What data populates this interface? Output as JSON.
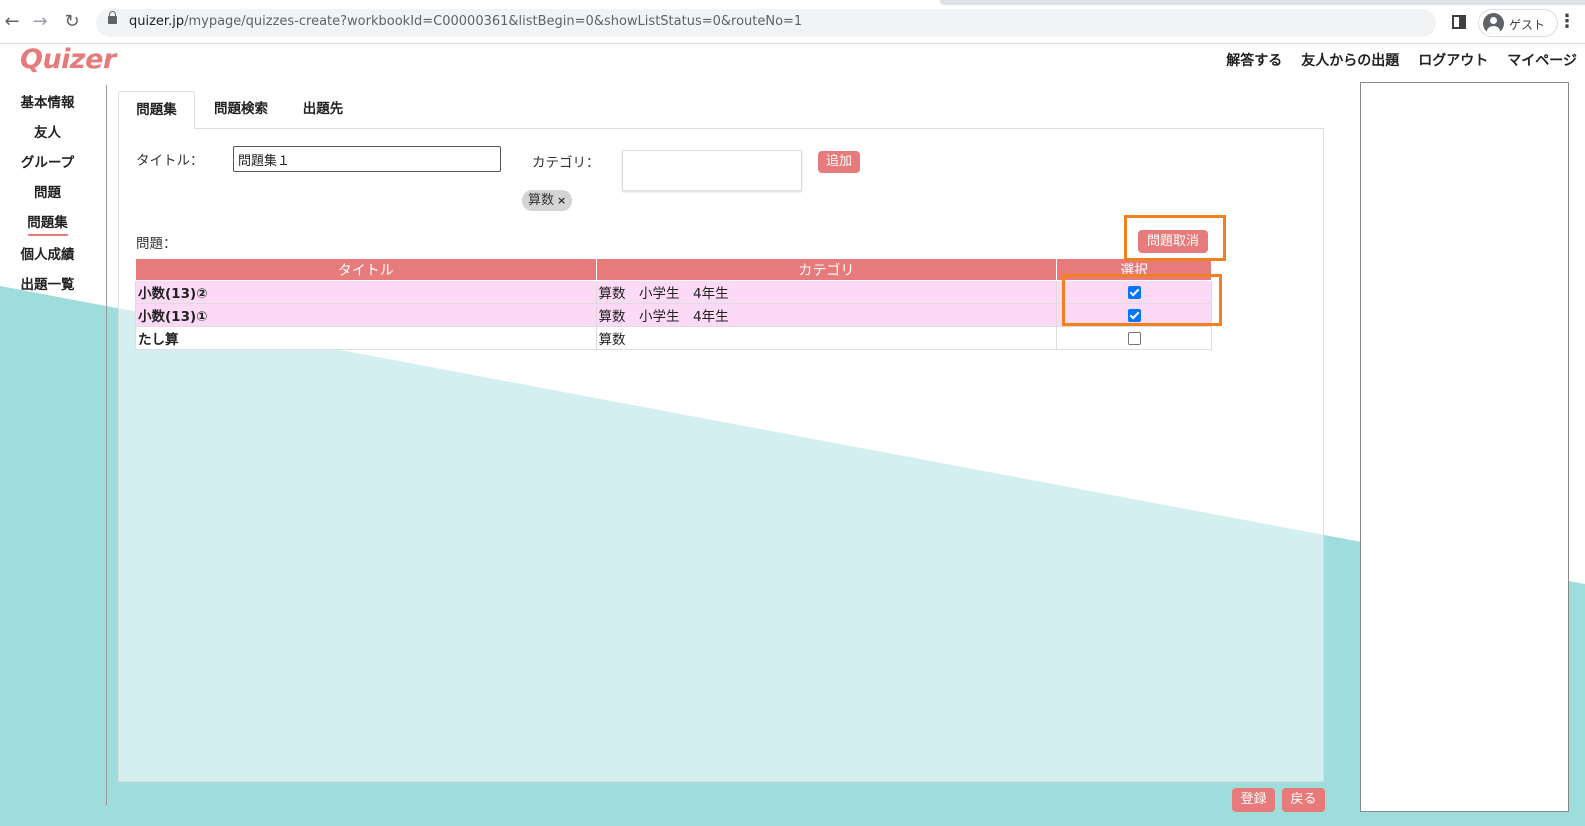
{
  "browser": {
    "url_host": "quizer.jp",
    "url_path": "/mypage/quizzes-create?workbookId=C00000361&listBegin=0&showListStatus=0&routeNo=1",
    "profile_label": "ゲスト"
  },
  "app": {
    "logo": "Quizer"
  },
  "topnav": {
    "items": [
      "解答する",
      "友人からの出題",
      "ログアウト",
      "マイページ"
    ]
  },
  "sidebar": {
    "items": [
      "基本情報",
      "友人",
      "グループ",
      "問題",
      "問題集",
      "個人成績",
      "出題一覧"
    ],
    "active": "問題集"
  },
  "tabs": {
    "items": [
      "問題集",
      "問題検索",
      "出題先"
    ],
    "active": "問題集"
  },
  "form": {
    "title_label": "タイトル：",
    "title_value": "問題集１",
    "category_label": "カテゴリ：",
    "add_button": "追加",
    "category_tags": [
      "算数"
    ],
    "questions_label": "問題：",
    "remove_button": "問題取消"
  },
  "table": {
    "headers": [
      "タイトル",
      "カテゴリ",
      "選択"
    ],
    "rows": [
      {
        "title": "小数(13)②",
        "category": "算数　小学生　4年生",
        "checked": true
      },
      {
        "title": "小数(13)①",
        "category": "算数　小学生　4年生",
        "checked": true
      },
      {
        "title": "たし算",
        "category": "算数",
        "checked": false
      }
    ]
  },
  "footer": {
    "register_button": "登録",
    "back_button": "戻る"
  },
  "colors": {
    "accent": "#e77a7a",
    "teal": "#9fdcdc",
    "selected_row": "#fcd9f5",
    "highlight": "#f08020"
  }
}
